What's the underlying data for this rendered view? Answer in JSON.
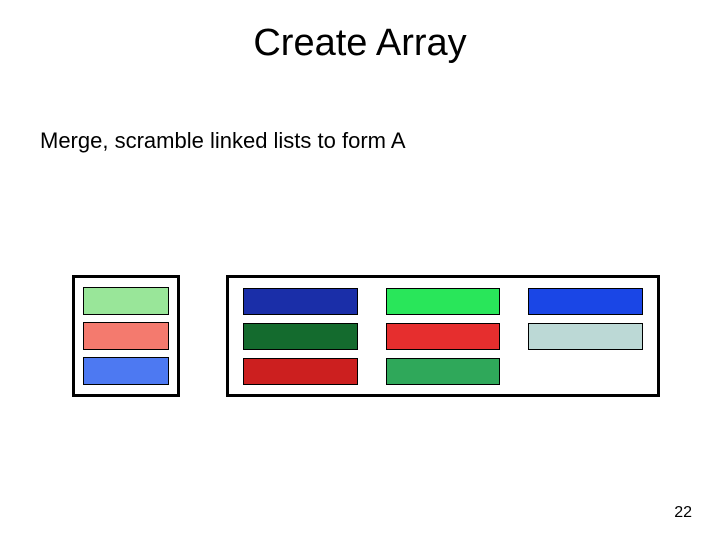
{
  "title": "Create Array",
  "subtitle": "Merge, scramble linked lists to form A",
  "page_number": "22",
  "left_array": {
    "cells": [
      {
        "color": "#99e699"
      },
      {
        "color": "#f47a6e"
      },
      {
        "color": "#4d79f2"
      }
    ]
  },
  "right_array": {
    "rows": 3,
    "cols": 3,
    "cells": [
      {
        "color": "#1a2ea8"
      },
      {
        "color": "#29e65a"
      },
      {
        "color": "#1a46e6"
      },
      {
        "color": "#146b2e"
      },
      {
        "color": "#e62e2e"
      },
      {
        "color": "#bcd9d6"
      },
      {
        "color": "#cc1f1f"
      },
      {
        "color": "#2fa85a"
      },
      null
    ]
  }
}
